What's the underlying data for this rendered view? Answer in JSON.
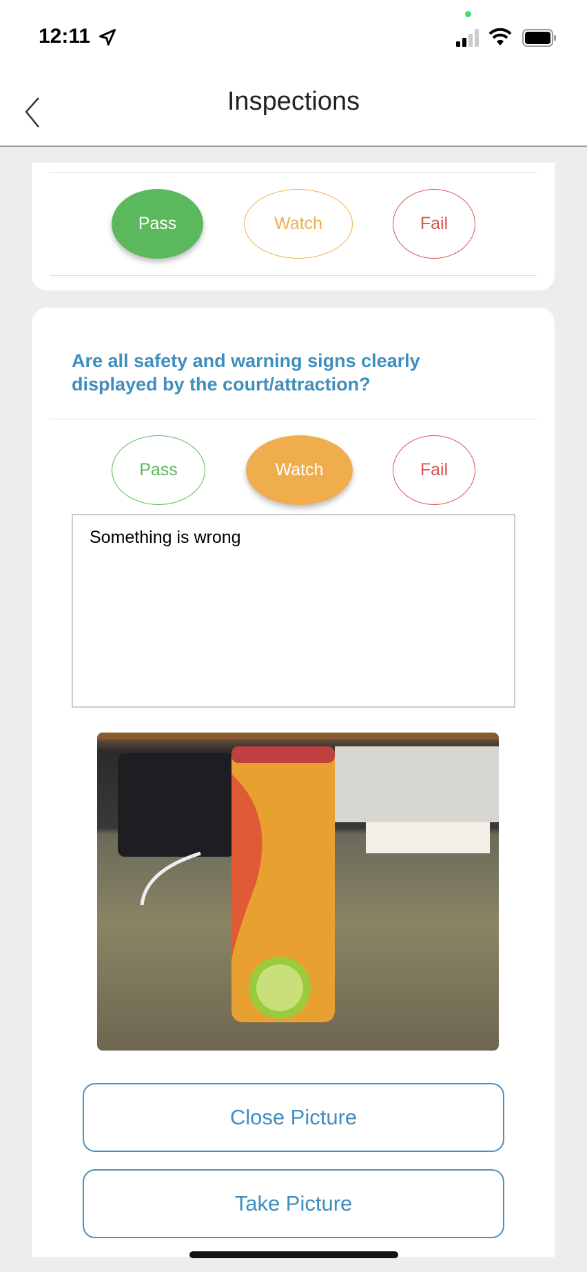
{
  "status_bar": {
    "time": "12:11"
  },
  "nav": {
    "title": "Inspections"
  },
  "previous_item": {
    "options": {
      "pass": "Pass",
      "watch": "Watch",
      "fail": "Fail"
    },
    "selected": "Pass"
  },
  "current_item": {
    "question": "Are all safety and warning signs clearly displayed by the court/attraction?",
    "options": {
      "pass": "Pass",
      "watch": "Watch",
      "fail": "Fail"
    },
    "selected": "Watch",
    "notes": "Something is wrong",
    "close_picture": "Close Picture",
    "take_picture": "Take Picture"
  },
  "colors": {
    "pass": "#5cb85c",
    "watch": "#f0ad4e",
    "fail": "#d9534f",
    "accent": "#3f8ebf"
  }
}
